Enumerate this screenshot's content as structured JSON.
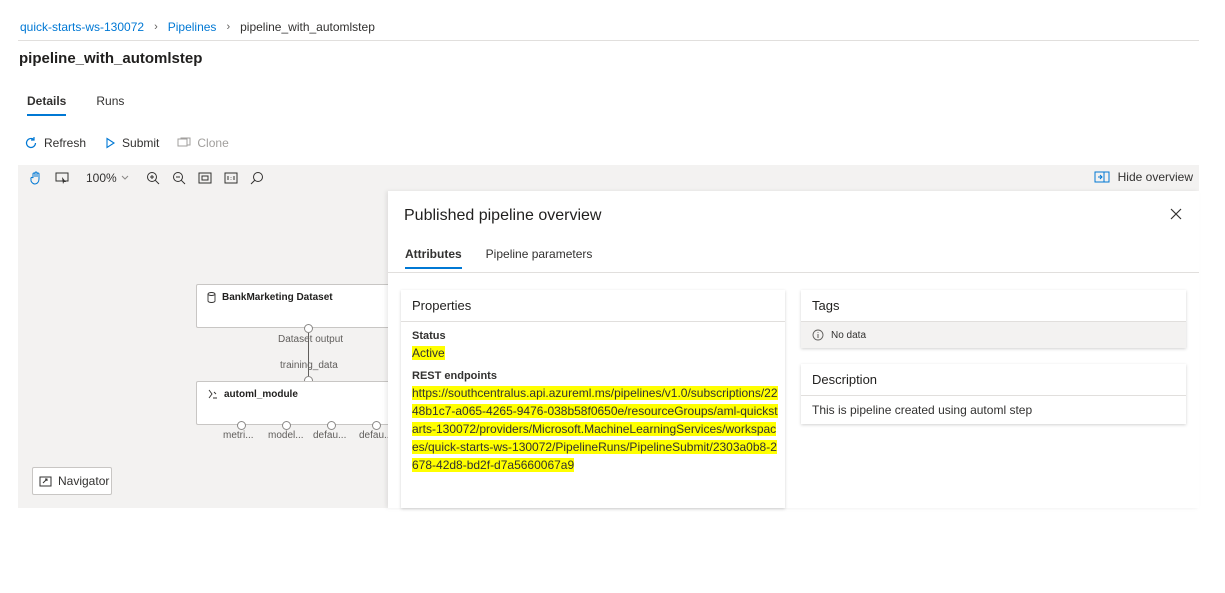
{
  "breadcrumb": {
    "workspace": "quick-starts-ws-130072",
    "pipelines": "Pipelines",
    "current": "pipeline_with_automlstep"
  },
  "page": {
    "title": "pipeline_with_automlstep"
  },
  "tabs": [
    {
      "label": "Details",
      "active": true
    },
    {
      "label": "Runs",
      "active": false
    }
  ],
  "commands": {
    "refresh": "Refresh",
    "submit": "Submit",
    "clone": "Clone"
  },
  "canvas_toolbar": {
    "zoom": "100%",
    "hide_overview": "Hide overview"
  },
  "canvas": {
    "dataset_node": {
      "title": "BankMarketing Dataset",
      "output_label": "Dataset output"
    },
    "connector_label": "training_data",
    "automl_node": {
      "title": "automl_module",
      "outputs": [
        "metri...",
        "model...",
        "defau...",
        "defau..."
      ]
    },
    "navigator": "Navigator"
  },
  "overview": {
    "title": "Published pipeline overview",
    "tabs": [
      {
        "label": "Attributes",
        "active": true
      },
      {
        "label": "Pipeline parameters",
        "active": false
      }
    ],
    "properties": {
      "header": "Properties",
      "status_label": "Status",
      "status_value": "Active",
      "endpoint_label": "REST endpoints",
      "endpoint_value": "https://southcentralus.api.azureml.ms/pipelines/v1.0/subscriptions/2248b1c7-a065-4265-9476-038b58f0650e/resourceGroups/aml-quickstarts-130072/providers/Microsoft.MachineLearningServices/workspaces/quick-starts-ws-130072/PipelineRuns/PipelineSubmit/2303a0b8-2678-42d8-bd2f-d7a5660067a9"
    },
    "tags": {
      "header": "Tags",
      "empty": "No data"
    },
    "description": {
      "header": "Description",
      "text": "This is pipeline created using automl step"
    }
  },
  "colors": {
    "accent": "#0078d4",
    "highlight": "#ffff00",
    "canvas_bg": "#f3f2f1"
  }
}
